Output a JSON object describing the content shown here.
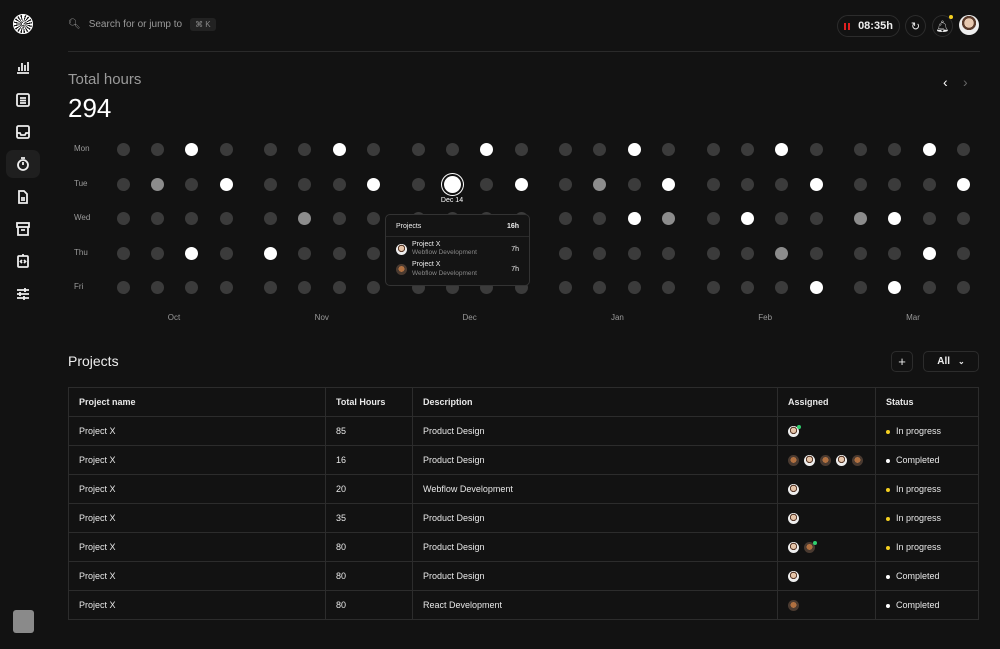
{
  "header": {
    "search_placeholder": "Search for or jump to",
    "shortcut": "⌘ K",
    "timer": "08:35h"
  },
  "colors": {
    "in_progress": "#f5d020",
    "completed": "#ffffff",
    "online": "#2ed06e",
    "pause": "#e02020"
  },
  "summary": {
    "title": "Total hours",
    "value": "294"
  },
  "heatmap": {
    "days": [
      "Mon",
      "Tue",
      "Wed",
      "Thu",
      "Fri"
    ],
    "months": [
      "Oct",
      "Nov",
      "Dec",
      "Jan",
      "Feb",
      "Mar"
    ],
    "levels_legend": "0=none,1=medium,2=high",
    "values": [
      [
        0,
        0,
        2,
        0,
        0,
        0,
        2,
        0,
        0,
        0,
        2,
        0,
        0,
        0,
        2,
        0,
        0,
        0,
        2,
        0,
        0,
        0,
        2,
        0
      ],
      [
        0,
        1,
        0,
        2,
        0,
        0,
        0,
        2,
        0,
        2,
        0,
        2,
        0,
        1,
        0,
        2,
        0,
        0,
        0,
        2,
        0,
        0,
        0,
        2
      ],
      [
        0,
        0,
        0,
        0,
        0,
        1,
        0,
        0,
        0,
        0,
        0,
        0,
        0,
        0,
        2,
        1,
        0,
        2,
        0,
        0,
        1,
        2,
        0,
        0
      ],
      [
        0,
        0,
        2,
        0,
        2,
        0,
        0,
        0,
        0,
        0,
        0,
        0,
        0,
        0,
        0,
        0,
        0,
        0,
        1,
        0,
        0,
        0,
        2,
        0
      ],
      [
        0,
        0,
        0,
        0,
        0,
        0,
        0,
        0,
        0,
        0,
        0,
        0,
        0,
        0,
        0,
        0,
        0,
        0,
        0,
        2,
        0,
        2,
        0,
        0
      ]
    ],
    "selected": {
      "label": "Dec 14",
      "day": 1,
      "col": 9
    }
  },
  "tooltip": {
    "title": "Projects",
    "total": "16h",
    "items": [
      {
        "name": "Project X",
        "desc": "Webflow Development",
        "hours": "7h",
        "avatar": "m"
      },
      {
        "name": "Project X",
        "desc": "Webflow Development",
        "hours": "7h",
        "avatar": "d"
      }
    ]
  },
  "projects": {
    "title": "Projects",
    "filter": "All",
    "columns": [
      "Project name",
      "Total Hours",
      "Description",
      "Assigned",
      "Status"
    ],
    "rows": [
      {
        "name": "Project X",
        "hours": "85",
        "desc": "Product Design",
        "assigned": [
          "m*"
        ],
        "status": "In progress"
      },
      {
        "name": "Project X",
        "hours": "16",
        "desc": "Product Design",
        "assigned": [
          "d",
          "m",
          "d",
          "m",
          "d"
        ],
        "status": "Completed"
      },
      {
        "name": "Project X",
        "hours": "20",
        "desc": "Webflow Development",
        "assigned": [
          "m"
        ],
        "status": "In progress"
      },
      {
        "name": "Project X",
        "hours": "35",
        "desc": "Product Design",
        "assigned": [
          "m"
        ],
        "status": "In progress"
      },
      {
        "name": "Project X",
        "hours": "80",
        "desc": "Product Design",
        "assigned": [
          "m",
          "d*"
        ],
        "status": "In progress"
      },
      {
        "name": "Project X",
        "hours": "80",
        "desc": "Product Design",
        "assigned": [
          "m"
        ],
        "status": "Completed"
      },
      {
        "name": "Project X",
        "hours": "80",
        "desc": "React Development",
        "assigned": [
          "d"
        ],
        "status": "Completed"
      }
    ]
  }
}
